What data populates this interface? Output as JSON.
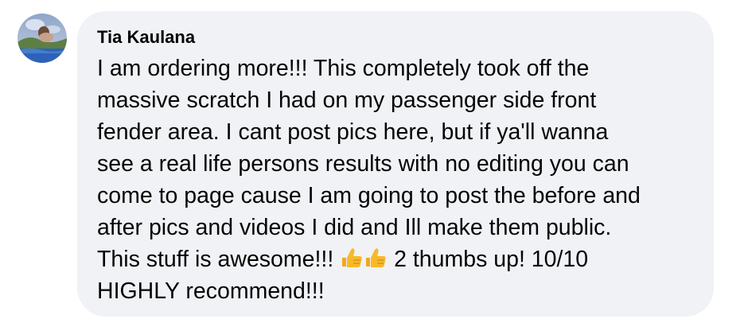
{
  "comment": {
    "author": "Tia Kaulana",
    "lines": [
      "I am ordering more!!! This completely took off the",
      "massive scratch I had on my passenger side front",
      "fender area. I cant post pics here, but if ya'll wanna",
      "see a real life persons results with no editing you can",
      "come to page cause I am going to post the before and",
      "after pics and videos I did and Ill make them public."
    ],
    "line7_start": "This stuff is awesome!!!",
    "line7_end": "2 thumbs up! 10/10",
    "line8": "HIGHLY recommend!!!",
    "emoji": [
      "thumbs-up-icon",
      "thumbs-up-icon"
    ]
  },
  "colors": {
    "bubble": "#f0f2f5",
    "text": "#050505",
    "emoji": "#f7b928"
  }
}
